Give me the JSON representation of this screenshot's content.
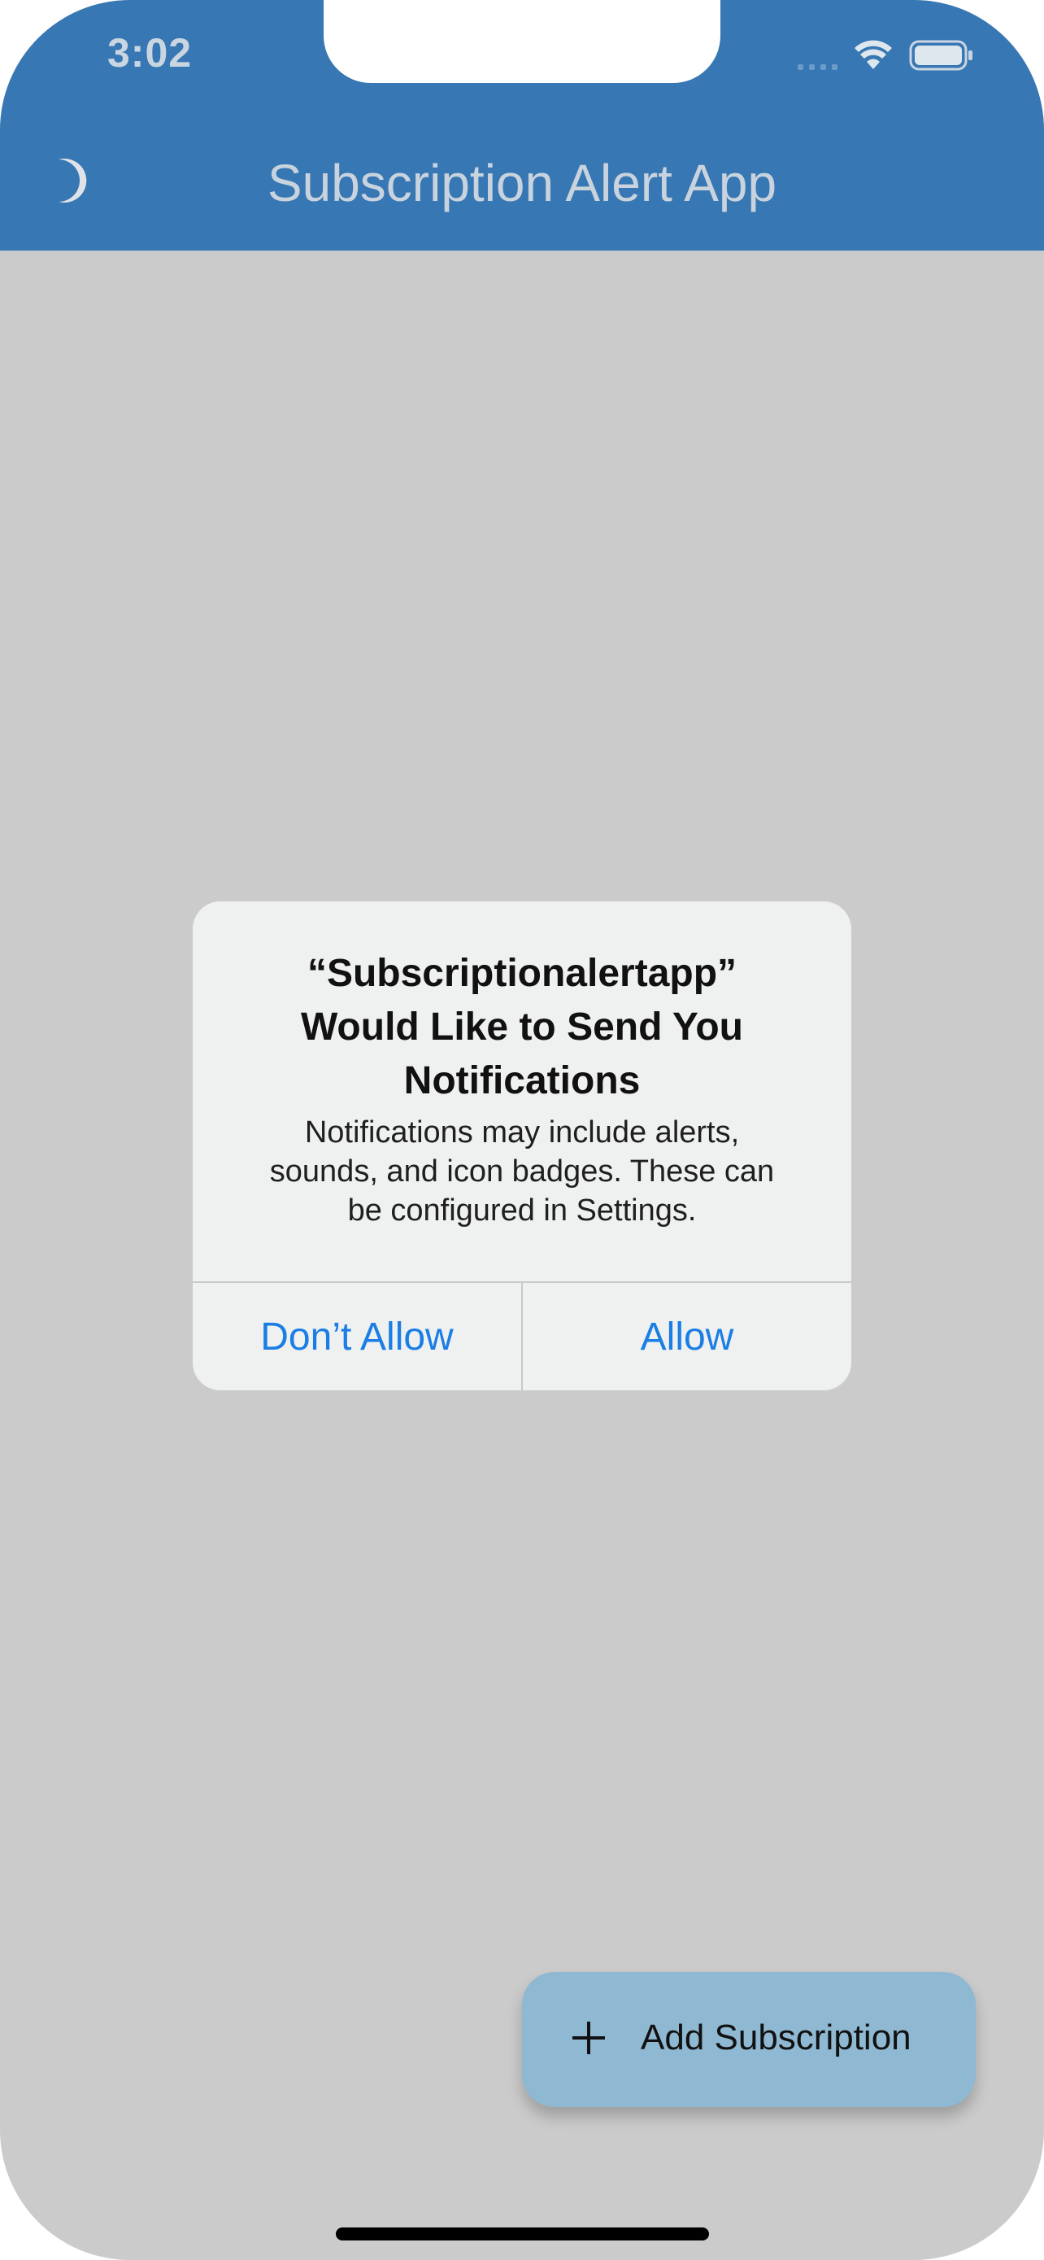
{
  "status_bar": {
    "time": "3:02",
    "icons": [
      "cellular-signal-icon",
      "wifi-icon",
      "battery-icon"
    ]
  },
  "app_bar": {
    "title": "Subscription Alert App",
    "leading_icon": "moon-icon",
    "background_color": "#3777b3"
  },
  "alert": {
    "title": "“Subscriptionalertapp” Would Like to Send You Notifications",
    "title_lines": [
      "“Subscriptionalertapp”",
      "Would Like to Send You",
      "Notifications"
    ],
    "message_lines": [
      "Notifications may include alerts,",
      "sounds, and icon badges. These can",
      "be configured in Settings."
    ],
    "buttons": {
      "deny": "Don’t Allow",
      "allow": "Allow"
    },
    "button_color": "#1a7ee4"
  },
  "fab": {
    "label": "Add Subscription",
    "icon": "plus-icon",
    "background_color": "#8fb8d2"
  }
}
